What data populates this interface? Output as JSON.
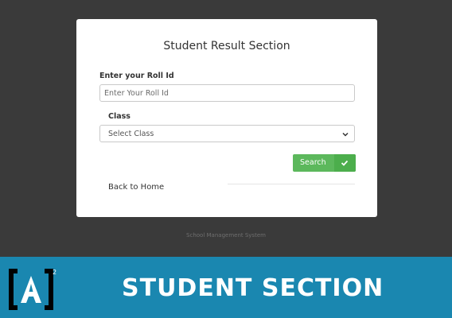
{
  "form": {
    "title": "Student Result Section",
    "roll_label": "Enter your Roll Id",
    "roll_placeholder": "Enter Your Roll Id",
    "roll_value": "",
    "class_label": "Class",
    "class_selected": "Select Class",
    "search_label": "Search",
    "back_link": "Back to Home"
  },
  "footer": {
    "text": "School Management System"
  },
  "banner": {
    "title": "STUDENT SECTION",
    "logo_text": "[A]²"
  },
  "colors": {
    "background": "#3a3a3a",
    "card": "#ffffff",
    "button": "#5cb85c",
    "banner": "#1a87b0"
  }
}
